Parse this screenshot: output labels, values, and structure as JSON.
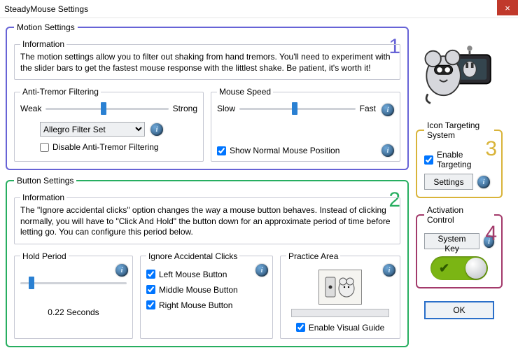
{
  "window": {
    "title": "SteadyMouse Settings",
    "close": "×"
  },
  "motion": {
    "legend": "Motion Settings",
    "number": "1",
    "info": {
      "legend": "Information",
      "text": "The motion settings allow you to filter out shaking from hand tremors. You'll need to experiment with the slider bars to get the fastest mouse response with the littlest shake. Be patient, it's worth it!"
    },
    "filter": {
      "legend": "Anti-Tremor Filtering",
      "weak": "Weak",
      "strong": "Strong",
      "slider_pct": 45,
      "select_value": "Allegro Filter Set",
      "disable_label": "Disable Anti-Tremor Filtering",
      "disable_checked": false
    },
    "speed": {
      "legend": "Mouse Speed",
      "slow": "Slow",
      "fast": "Fast",
      "slider_pct": 45,
      "show_pos_label": "Show Normal Mouse Position",
      "show_pos_checked": true
    }
  },
  "buttons": {
    "legend": "Button Settings",
    "number": "2",
    "info": {
      "legend": "Information",
      "text": "The \"Ignore accidental clicks\" option changes the way a mouse button behaves. Instead of clicking normally, you will have to \"Click And Hold\" the button down for an approximate period of time before letting go. You can configure this period below."
    },
    "hold": {
      "legend": "Hold Period",
      "slider_pct": 8,
      "value": "0.22 Seconds"
    },
    "ignore": {
      "legend": "Ignore Accidental Clicks",
      "left_label": "Left Mouse Button",
      "left_checked": true,
      "middle_label": "Middle Mouse Button",
      "middle_checked": true,
      "right_label": "Right Mouse Button",
      "right_checked": true
    },
    "practice": {
      "legend": "Practice Area",
      "guide_label": "Enable Visual Guide",
      "guide_checked": true
    }
  },
  "targeting": {
    "legend": "Icon Targeting System",
    "number": "3",
    "enable_label": "Enable Targeting",
    "enable_checked": true,
    "settings_btn": "Settings"
  },
  "activation": {
    "legend": "Activation Control",
    "number": "4",
    "syskey_btn": "System Key",
    "toggle_on": true
  },
  "ok": "OK"
}
